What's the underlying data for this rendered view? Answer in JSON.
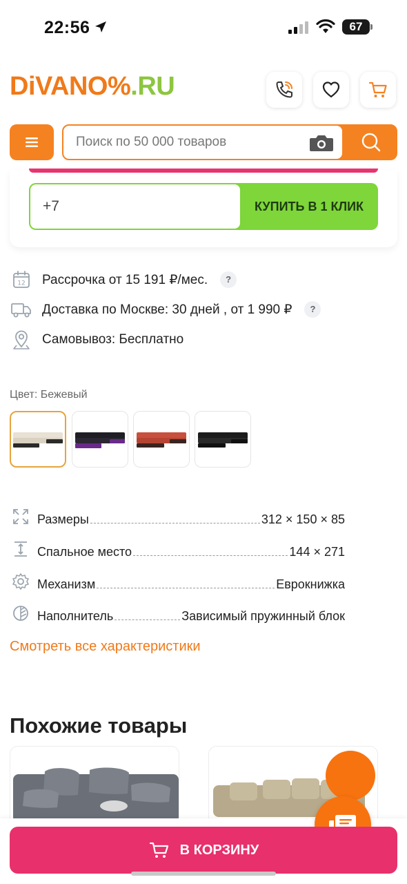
{
  "status_bar": {
    "time": "22:56",
    "battery": "67"
  },
  "header": {
    "logo_part1": "DiVANO",
    "logo_part2": "%",
    "logo_part3": ".RU",
    "search_placeholder": "Поиск по 50 000 товаров",
    "brand_orange": "#f58220",
    "brand_green": "#8dc63f"
  },
  "order": {
    "phone_prefix": "+7",
    "buy_one_click": "КУПИТЬ В 1 КЛИК"
  },
  "info": {
    "installment": "Рассрочка от 15 191 ₽/мес.",
    "delivery": "Доставка по Москве: 30 дней , от 1 990 ₽",
    "pickup": "Самовывоз: Бесплатно",
    "help_mark": "?"
  },
  "color": {
    "label": "Цвет: Бежевый",
    "swatches": [
      "beige",
      "black-purple",
      "red",
      "black"
    ]
  },
  "specs": [
    {
      "name": "Размеры",
      "value": "312 × 150 × 85",
      "icon": "expand-icon"
    },
    {
      "name": "Спальное место",
      "value": "144 × 271",
      "icon": "bed-height-icon"
    },
    {
      "name": "Механизм",
      "value": "Еврокнижка",
      "icon": "gear-icon"
    },
    {
      "name": "Наполнитель",
      "value": "Зависимый пружинный блок",
      "icon": "filler-icon"
    }
  ],
  "specs_link": "Смотреть все характеристики",
  "similar": {
    "title": "Похожие товары"
  },
  "cart": {
    "label": "В КОРЗИНУ",
    "color": "#e8306c"
  }
}
